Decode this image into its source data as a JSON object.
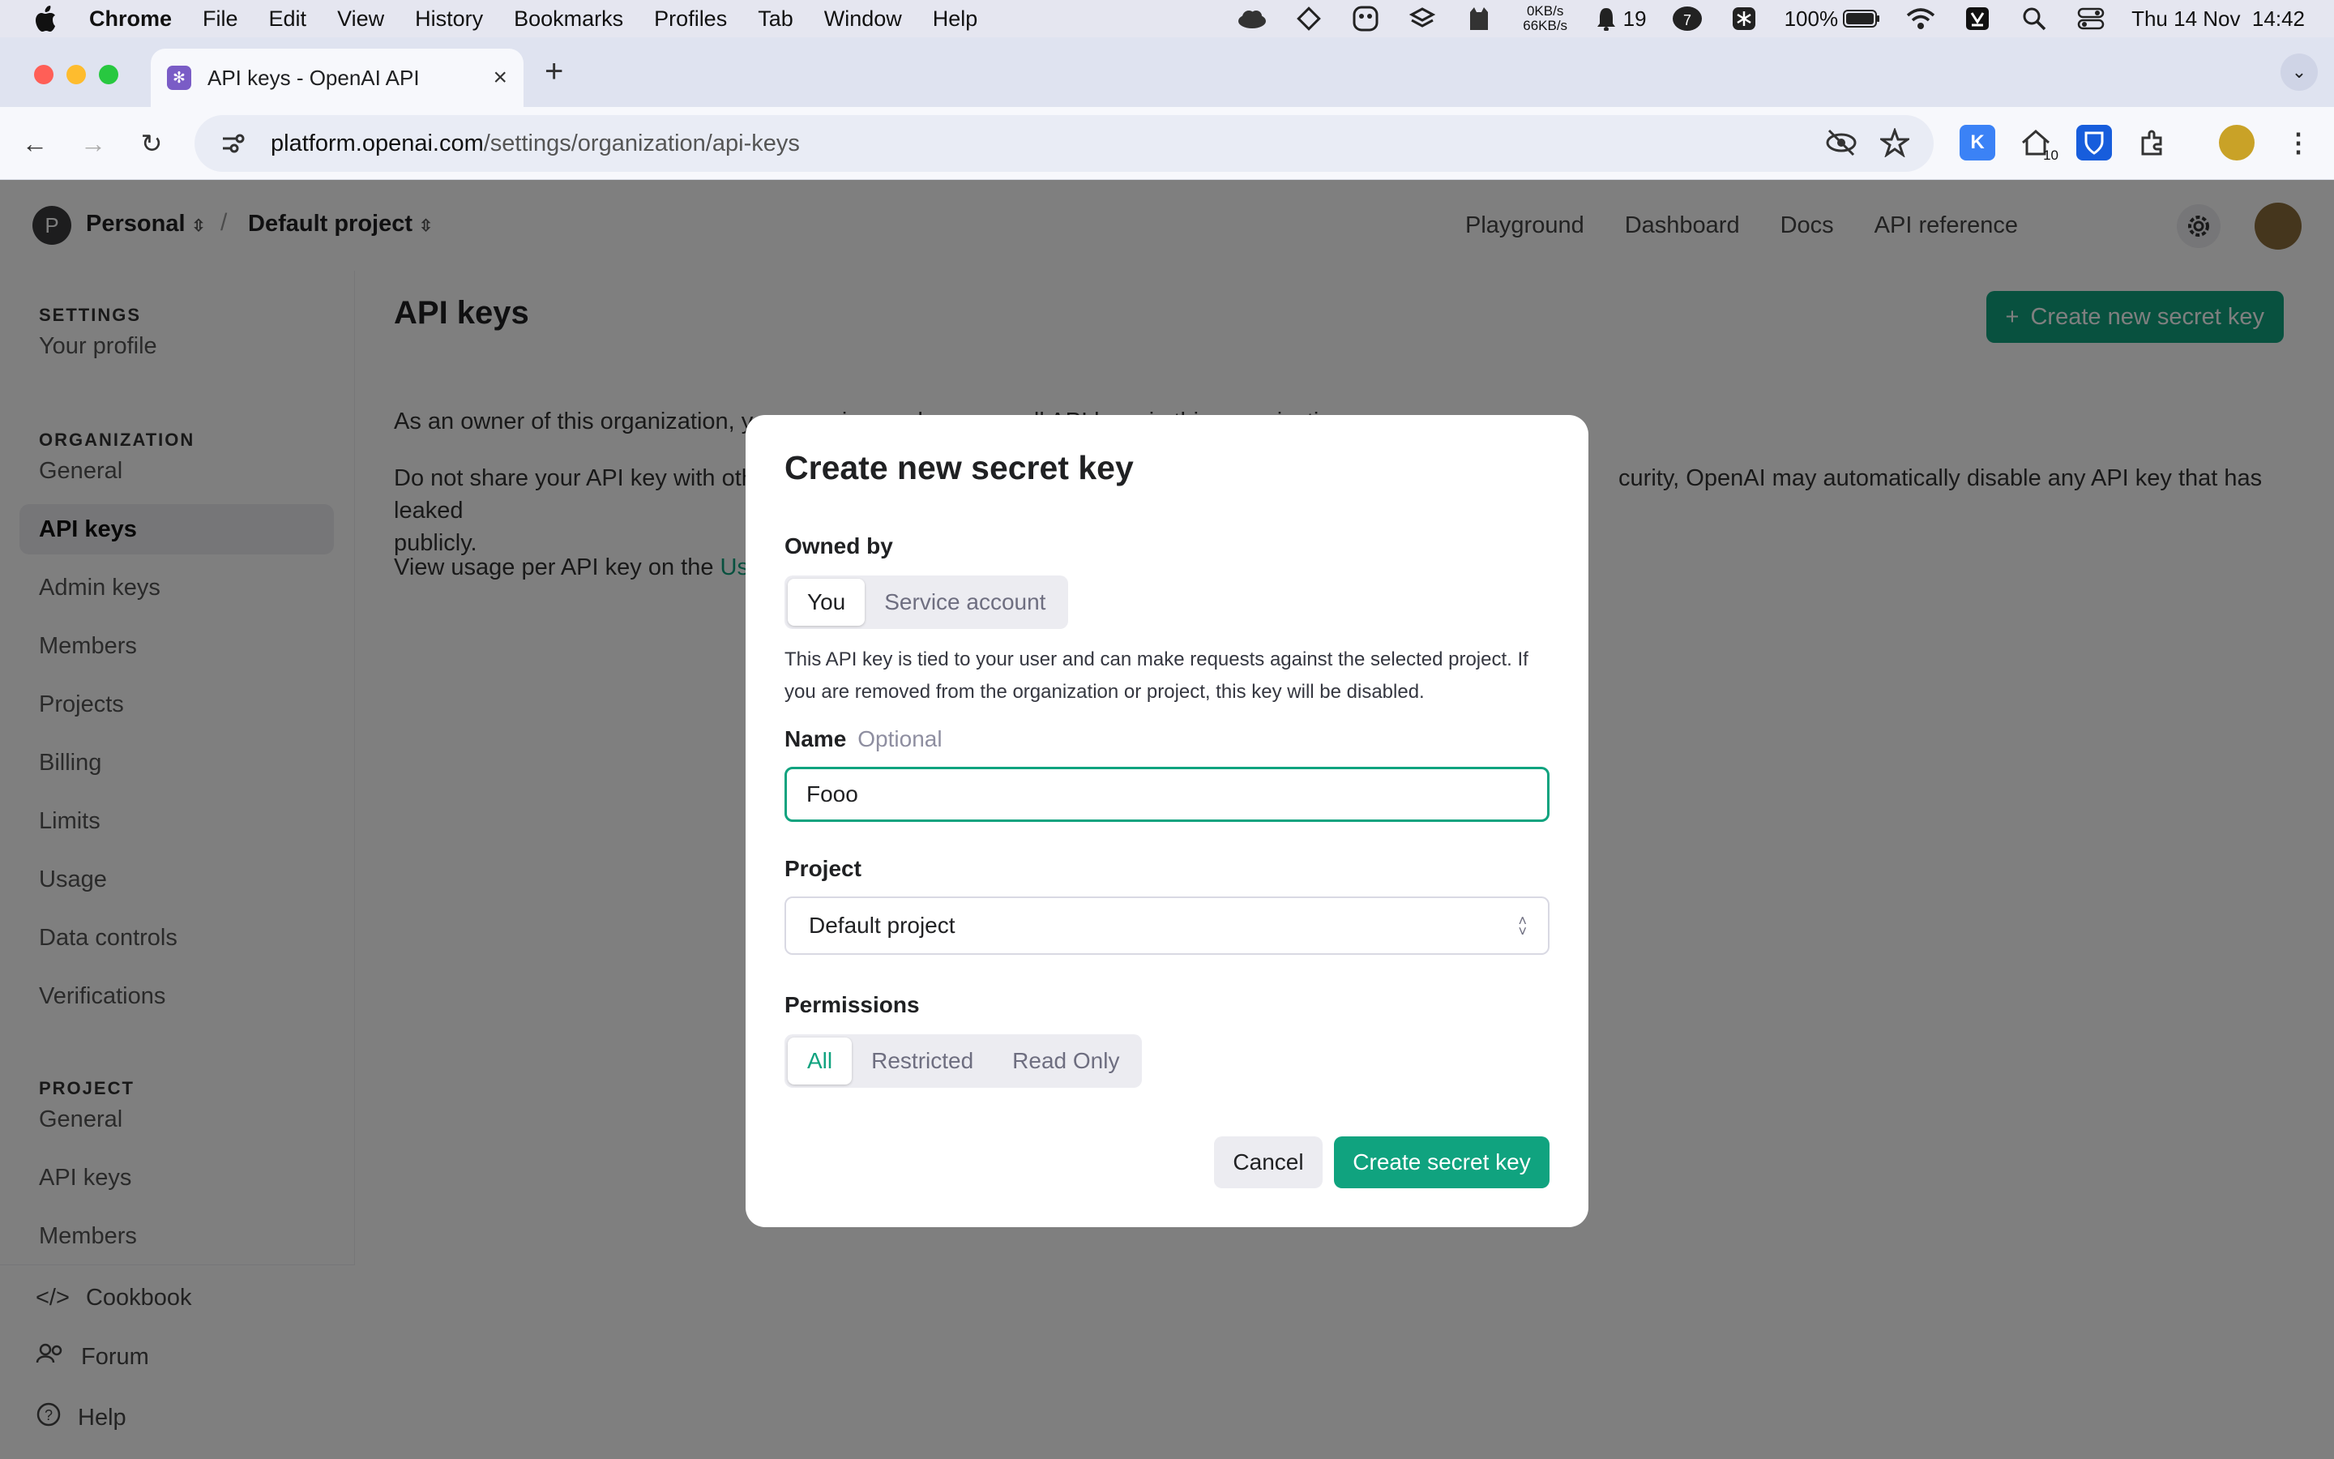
{
  "menubar": {
    "app": "Chrome",
    "items": [
      "File",
      "Edit",
      "View",
      "History",
      "Bookmarks",
      "Profiles",
      "Tab",
      "Window",
      "Help"
    ],
    "net_up": "0KB/s",
    "net_down": "66KB/s",
    "notifications": "19",
    "badge_count": "7",
    "battery": "100%",
    "datetime": "Thu 14 Nov  14:42"
  },
  "browser": {
    "tab_title": "API keys - OpenAI API",
    "url_host": "platform.openai.com",
    "url_path": "/settings/organization/api-keys",
    "ext_badge": "10"
  },
  "topnav": {
    "org_initial": "P",
    "org": "Personal",
    "separator": "/",
    "project": "Default project",
    "links": [
      "Playground",
      "Dashboard",
      "Docs",
      "API reference"
    ]
  },
  "sidebar": {
    "settings_heading": "SETTINGS",
    "profile": "Your profile",
    "org_heading": "ORGANIZATION",
    "org_items": [
      "General",
      "API keys",
      "Admin keys",
      "Members",
      "Projects",
      "Billing",
      "Limits",
      "Usage",
      "Data controls",
      "Verifications"
    ],
    "project_heading": "PROJECT",
    "project_items": [
      "General",
      "API keys",
      "Members"
    ],
    "bottom": [
      "Cookbook",
      "Forum",
      "Help"
    ]
  },
  "main": {
    "title": "API keys",
    "create_button": "Create new secret key",
    "para1": "As an owner of this organization, you can view and manage all API keys in this organization.",
    "para2_start": "Do not share your API key with othe",
    "para2_end": "curity, OpenAI may automatically disable any API key that has leaked",
    "para2_line2": "publicly.",
    "para3_start": "View usage per API key on the ",
    "para3_link": "Usag"
  },
  "modal": {
    "title": "Create new secret key",
    "owned_by_label": "Owned by",
    "owner_options": [
      "You",
      "Service account"
    ],
    "owner_selected": "You",
    "description": "This API key is tied to your user and can make requests against the selected project. If you are removed from the organization or project, this key will be disabled.",
    "name_label": "Name",
    "name_optional": "Optional",
    "name_value": "Fooo",
    "project_label": "Project",
    "project_value": "Default project",
    "permissions_label": "Permissions",
    "permission_options": [
      "All",
      "Restricted",
      "Read Only"
    ],
    "permission_selected": "All",
    "cancel": "Cancel",
    "submit": "Create secret key"
  },
  "colors": {
    "accent": "#10a37f",
    "overlay": "rgba(0,0,0,0.5)"
  }
}
